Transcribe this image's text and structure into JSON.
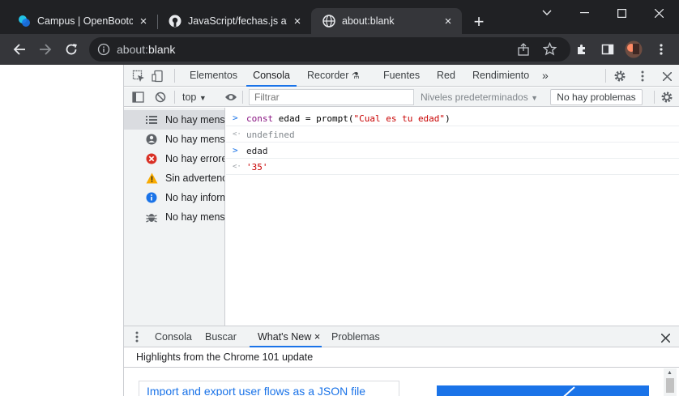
{
  "browser": {
    "tabs": [
      {
        "title": "Campus | OpenBootcamp",
        "icon": "openbootcamp-icon"
      },
      {
        "title": "JavaScript/fechas.js at main",
        "icon": "github-icon"
      },
      {
        "title": "about:blank",
        "icon": "globe-icon",
        "active": true
      }
    ],
    "new_tab_label": "+",
    "address": {
      "prefix": "about:",
      "host": "blank"
    }
  },
  "devtools": {
    "tabs": [
      "Elementos",
      "Consola",
      "Recorder",
      "Fuentes",
      "Red",
      "Rendimiento"
    ],
    "active_tab": "Consola",
    "more_tabs": "»",
    "console_bar": {
      "context": "top",
      "filter_placeholder": "Filtrar",
      "levels": "Niveles predeterminados",
      "issues": "No hay problemas"
    },
    "sidebar": [
      {
        "label": "No hay mensajes",
        "icon": "list-icon",
        "selected": true,
        "color": "#5f6368"
      },
      {
        "label": "No hay mensajes de usuario",
        "icon": "user-icon",
        "color": "#5f6368"
      },
      {
        "label": "No hay errores",
        "icon": "error-icon",
        "color": "#d93025"
      },
      {
        "label": "Sin advertencias",
        "icon": "warning-icon",
        "color": "#f9ab00"
      },
      {
        "label": "No hay información",
        "icon": "info-icon",
        "color": "#1a73e8"
      },
      {
        "label": "No hay mensajes detallados",
        "icon": "bug-icon",
        "color": "#5f6368"
      }
    ],
    "console_lines": [
      {
        "kind": "input",
        "arrow": ">",
        "text": "const edad = prompt(\"Cual es tu edad\")"
      },
      {
        "kind": "output",
        "arrow": "<·",
        "text": "undefined"
      },
      {
        "kind": "input",
        "arrow": ">",
        "text": "edad"
      },
      {
        "kind": "output",
        "arrow": "<·",
        "text": "'35'"
      }
    ],
    "drawer": {
      "tabs": [
        "Consola",
        "Buscar",
        "What's New",
        "Problemas"
      ],
      "active_tab": "What's New",
      "highlights": "Highlights from the Chrome 101 update",
      "feature_title": "Import and export user flows as a JSON file"
    }
  },
  "colors": {
    "accent": "#1a73e8",
    "string": "#c80000",
    "keyword": "#881280"
  }
}
